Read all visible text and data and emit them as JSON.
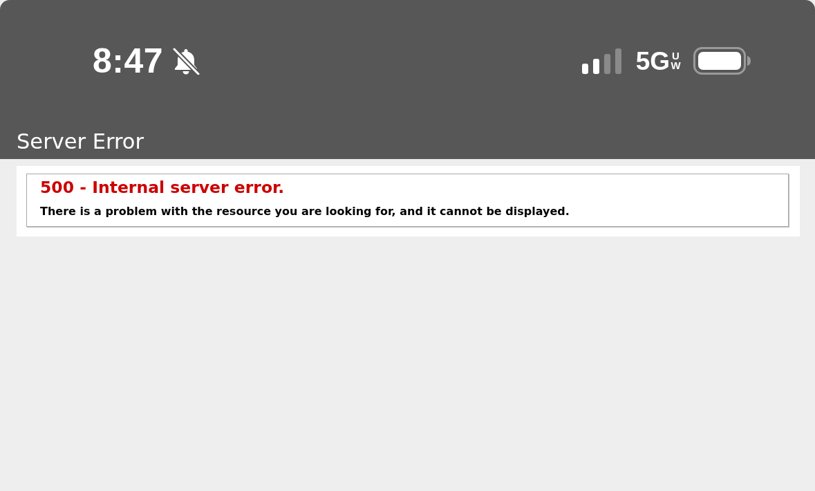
{
  "status_bar": {
    "time": "8:47",
    "network": "5G",
    "network_badge": "UW"
  },
  "header": {
    "title": "Server Error"
  },
  "error": {
    "heading": "500 - Internal server error.",
    "message": "There is a problem with the resource you are looking for, and it cannot be displayed."
  }
}
